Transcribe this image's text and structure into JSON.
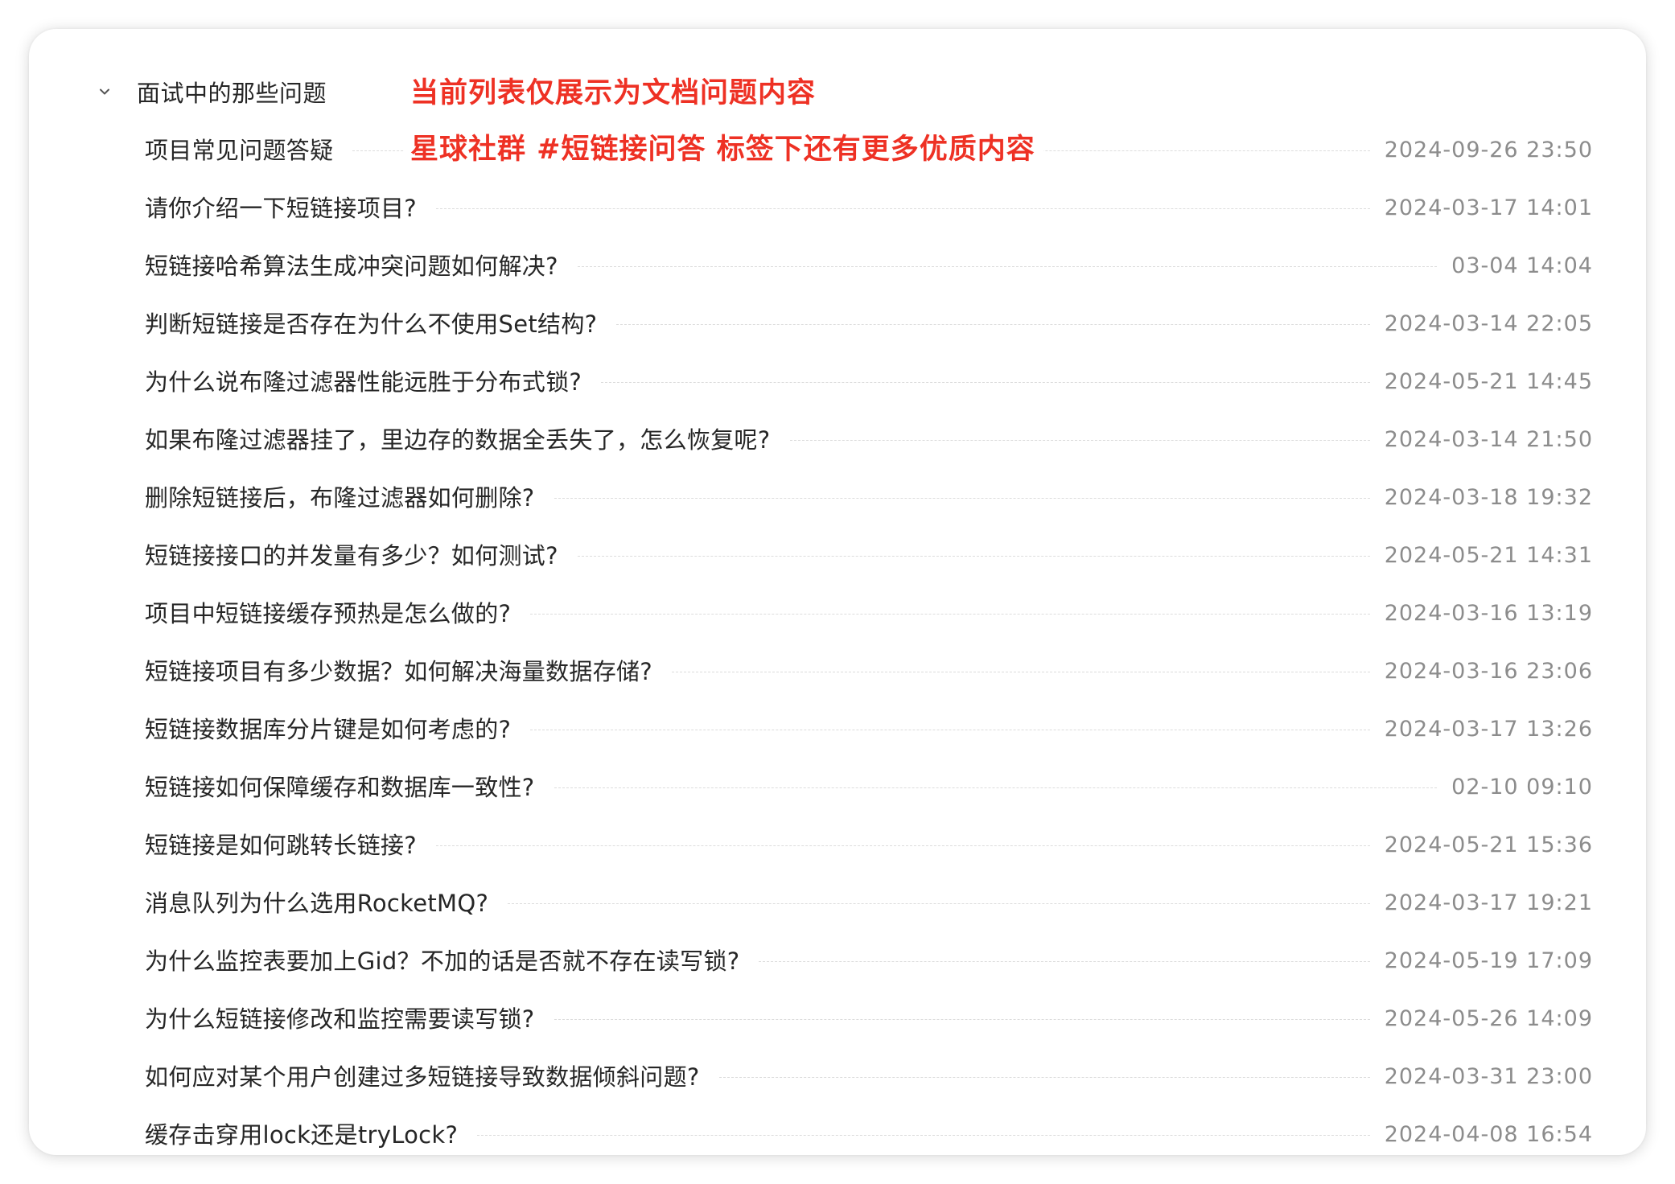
{
  "group": {
    "title": "面试中的那些问题",
    "chevron_icon": "chevron-down-icon"
  },
  "notice": {
    "line1": "当前列表仅展示为文档问题内容",
    "line2": "星球社群 #短链接问答 标签下还有更多优质内容",
    "color": "#ee3124"
  },
  "items": [
    {
      "title": "项目常见问题答疑",
      "date": "2024-09-26 23:50"
    },
    {
      "title": "请你介绍一下短链接项目?",
      "date": "2024-03-17 14:01"
    },
    {
      "title": "短链接哈希算法生成冲突问题如何解决?",
      "date": "03-04 14:04"
    },
    {
      "title": "判断短链接是否存在为什么不使用Set结构?",
      "date": "2024-03-14 22:05"
    },
    {
      "title": "为什么说布隆过滤器性能远胜于分布式锁?",
      "date": "2024-05-21 14:45"
    },
    {
      "title": "如果布隆过滤器挂了，里边存的数据全丢失了，怎么恢复呢?",
      "date": "2024-03-14 21:50"
    },
    {
      "title": "删除短链接后，布隆过滤器如何删除?",
      "date": "2024-03-18 19:32"
    },
    {
      "title": "短链接接口的并发量有多少？如何测试?",
      "date": "2024-05-21 14:31"
    },
    {
      "title": "项目中短链接缓存预热是怎么做的?",
      "date": "2024-03-16 13:19"
    },
    {
      "title": "短链接项目有多少数据？如何解决海量数据存储?",
      "date": "2024-03-16 23:06"
    },
    {
      "title": "短链接数据库分片键是如何考虑的?",
      "date": "2024-03-17 13:26"
    },
    {
      "title": "短链接如何保障缓存和数据库一致性?",
      "date": "02-10 09:10"
    },
    {
      "title": "短链接是如何跳转长链接?",
      "date": "2024-05-21 15:36"
    },
    {
      "title": "消息队列为什么选用RocketMQ?",
      "date": "2024-03-17 19:21"
    },
    {
      "title": "为什么监控表要加上Gid？不加的话是否就不存在读写锁?",
      "date": "2024-05-19 17:09"
    },
    {
      "title": "为什么短链接修改和监控需要读写锁?",
      "date": "2024-05-26 14:09"
    },
    {
      "title": "如何应对某个用户创建过多短链接导致数据倾斜问题?",
      "date": "2024-03-31 23:00"
    },
    {
      "title": "缓存击穿用lock还是tryLock?",
      "date": "2024-04-08 16:54"
    }
  ]
}
